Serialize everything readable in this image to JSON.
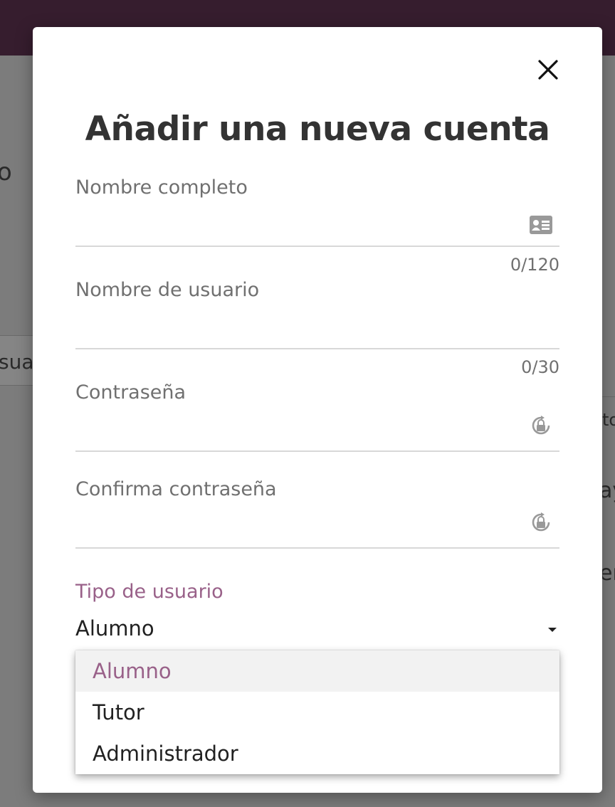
{
  "background": {
    "fragments": [
      "o",
      "sua",
      "to",
      "ay",
      "en"
    ]
  },
  "modal": {
    "title": "Añadir una nueva cuenta",
    "fields": {
      "full_name": {
        "label": "Nombre completo",
        "value": "",
        "counter": "0/120"
      },
      "username": {
        "label": "Nombre de usuario",
        "value": "",
        "counter": "0/30"
      },
      "password": {
        "label": "Contraseña",
        "value": ""
      },
      "confirm_password": {
        "label": "Confirma contraseña",
        "value": ""
      }
    },
    "user_type": {
      "label": "Tipo de usuario",
      "selected": "Alumno",
      "options": [
        "Alumno",
        "Tutor",
        "Administrador"
      ]
    }
  },
  "colors": {
    "app_bar": "#361d2e",
    "accent": "#996189",
    "label": "#707070",
    "text": "#212121"
  },
  "icons": {
    "close": "close-icon",
    "full_name": "id-card-icon",
    "password": "lock-refresh-icon",
    "confirm_password": "lock-refresh-icon",
    "select": "caret-down-icon"
  }
}
